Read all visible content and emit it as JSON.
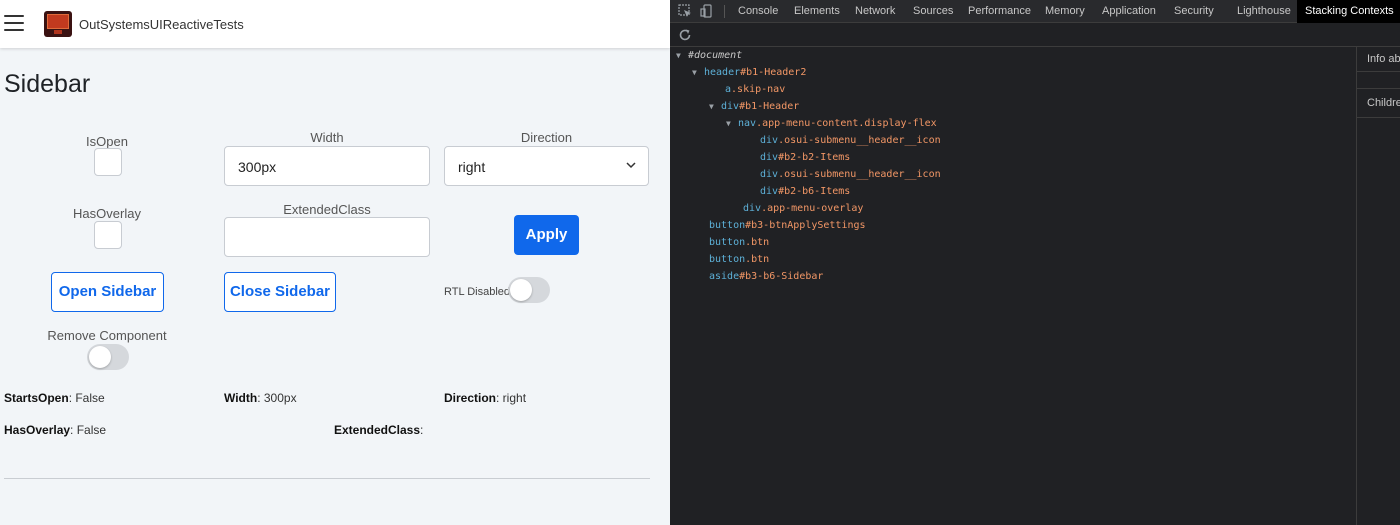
{
  "app": {
    "name": "OutSystemsUIReactiveTests",
    "page_title": "Sidebar",
    "form": {
      "isopen_label": "IsOpen",
      "width_label": "Width",
      "width_value": "300px",
      "direction_label": "Direction",
      "direction_value": "right",
      "hasoverlay_label": "HasOverlay",
      "extendedclass_label": "ExtendedClass",
      "extendedclass_value": "",
      "apply_label": "Apply",
      "open_sidebar_label": "Open Sidebar",
      "close_sidebar_label": "Close Sidebar",
      "rtl_label": "RTL Disabled",
      "remove_component_label": "Remove Component"
    },
    "info": {
      "starts_open_key": "StartsOpen",
      "starts_open_value": ": False",
      "width_key": "Width",
      "width_value": ": 300px",
      "direction_key": "Direction",
      "direction_value": ": right",
      "has_overlay_key": "HasOverlay",
      "has_overlay_value": ": False",
      "extended_class_key": "ExtendedClass",
      "extended_class_value": ":"
    },
    "colors": {
      "primary": "#1068eb",
      "background": "#f2f5f8"
    }
  },
  "devtools": {
    "tabs": [
      {
        "label": "Console"
      },
      {
        "label": "Elements"
      },
      {
        "label": "Network"
      },
      {
        "label": "Sources"
      },
      {
        "label": "Performance"
      },
      {
        "label": "Memory"
      },
      {
        "label": "Application"
      },
      {
        "label": "Security"
      },
      {
        "label": "Lighthouse"
      },
      {
        "label": "Stacking Contexts"
      }
    ],
    "active_tab": "Stacking Contexts",
    "tree": [
      {
        "tag": "#document",
        "attr": ""
      },
      {
        "tag": "header",
        "attr": "#b1-Header2"
      },
      {
        "tag": "a",
        "attr": ".skip-nav"
      },
      {
        "tag": "div",
        "attr": "#b1-Header"
      },
      {
        "tag": "nav",
        "attr": ".app-menu-content.display-flex"
      },
      {
        "tag": "div",
        "attr": ".osui-submenu__header__icon"
      },
      {
        "tag": "div",
        "attr": "#b2-b2-Items"
      },
      {
        "tag": "div",
        "attr": ".osui-submenu__header__icon"
      },
      {
        "tag": "div",
        "attr": "#b2-b6-Items"
      },
      {
        "tag": "div",
        "attr": ".app-menu-overlay"
      },
      {
        "tag": "button",
        "attr": "#b3-btnApplySettings"
      },
      {
        "tag": "button",
        "attr": ".btn"
      },
      {
        "tag": "button",
        "attr": ".btn"
      },
      {
        "tag": "aside",
        "attr": "#b3-b6-Sidebar"
      }
    ],
    "side_panel": {
      "info_label": "Info ab",
      "children_label": "Childre"
    },
    "colors": {
      "tag": "#5db0d7",
      "attr": "#f29766"
    }
  }
}
